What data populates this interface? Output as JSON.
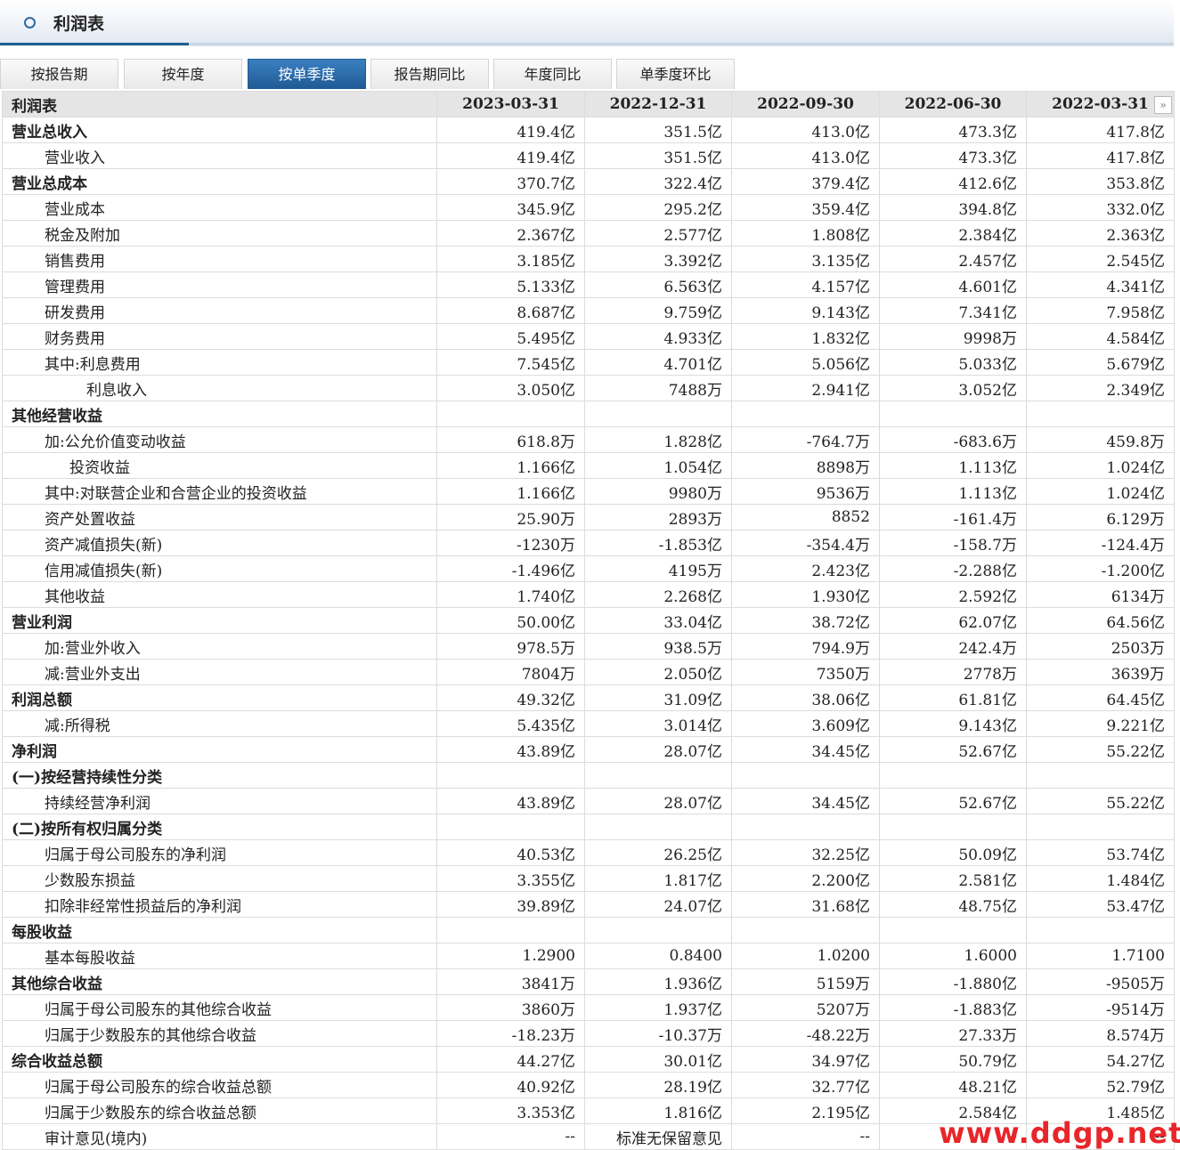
{
  "page_title": "利润表",
  "tabs": [
    {
      "label": "按报告期"
    },
    {
      "label": "按年度"
    },
    {
      "label": "按单季度",
      "active": true
    },
    {
      "label": "报告期同比"
    },
    {
      "label": "年度同比"
    },
    {
      "label": "单季度环比"
    }
  ],
  "table": {
    "header_label": "利润表",
    "columns": [
      "2023-03-31",
      "2022-12-31",
      "2022-09-30",
      "2022-06-30",
      "2022-03-31"
    ],
    "rows": [
      {
        "label": "营业总收入",
        "level": 0,
        "bold": true,
        "values": [
          "419.4亿",
          "351.5亿",
          "413.0亿",
          "473.3亿",
          "417.8亿"
        ]
      },
      {
        "label": "营业收入",
        "level": 1,
        "values": [
          "419.4亿",
          "351.5亿",
          "413.0亿",
          "473.3亿",
          "417.8亿"
        ]
      },
      {
        "label": "营业总成本",
        "level": 0,
        "bold": true,
        "values": [
          "370.7亿",
          "322.4亿",
          "379.4亿",
          "412.6亿",
          "353.8亿"
        ]
      },
      {
        "label": "营业成本",
        "level": 1,
        "values": [
          "345.9亿",
          "295.2亿",
          "359.4亿",
          "394.8亿",
          "332.0亿"
        ]
      },
      {
        "label": "税金及附加",
        "level": 1,
        "values": [
          "2.367亿",
          "2.577亿",
          "1.808亿",
          "2.384亿",
          "2.363亿"
        ]
      },
      {
        "label": "销售费用",
        "level": 1,
        "values": [
          "3.185亿",
          "3.392亿",
          "3.135亿",
          "2.457亿",
          "2.545亿"
        ]
      },
      {
        "label": "管理费用",
        "level": 1,
        "values": [
          "5.133亿",
          "6.563亿",
          "4.157亿",
          "4.601亿",
          "4.341亿"
        ]
      },
      {
        "label": "研发费用",
        "level": 1,
        "values": [
          "8.687亿",
          "9.759亿",
          "9.143亿",
          "7.341亿",
          "7.958亿"
        ]
      },
      {
        "label": "财务费用",
        "level": 1,
        "values": [
          "5.495亿",
          "4.933亿",
          "1.832亿",
          "9998万",
          "4.584亿"
        ]
      },
      {
        "label": "其中:利息费用",
        "level": 1,
        "values": [
          "7.545亿",
          "4.701亿",
          "5.056亿",
          "5.033亿",
          "5.679亿"
        ]
      },
      {
        "label": "利息收入",
        "level": 3,
        "values": [
          "3.050亿",
          "7488万",
          "2.941亿",
          "3.052亿",
          "2.349亿"
        ]
      },
      {
        "label": "其他经营收益",
        "level": 0,
        "bold": true,
        "values": [
          "",
          "",
          "",
          "",
          ""
        ]
      },
      {
        "label": "加:公允价值变动收益",
        "level": 1,
        "values": [
          "618.8万",
          "1.828亿",
          "-764.7万",
          "-683.6万",
          "459.8万"
        ]
      },
      {
        "label": "投资收益",
        "level": 2,
        "values": [
          "1.166亿",
          "1.054亿",
          "8898万",
          "1.113亿",
          "1.024亿"
        ]
      },
      {
        "label": "其中:对联营企业和合营企业的投资收益",
        "level": 1,
        "values": [
          "1.166亿",
          "9980万",
          "9536万",
          "1.113亿",
          "1.024亿"
        ]
      },
      {
        "label": "资产处置收益",
        "level": 1,
        "values": [
          "25.90万",
          "2893万",
          "8852",
          "-161.4万",
          "6.129万"
        ]
      },
      {
        "label": "资产减值损失(新)",
        "level": 1,
        "values": [
          "-1230万",
          "-1.853亿",
          "-354.4万",
          "-158.7万",
          "-124.4万"
        ]
      },
      {
        "label": "信用减值损失(新)",
        "level": 1,
        "values": [
          "-1.496亿",
          "4195万",
          "2.423亿",
          "-2.288亿",
          "-1.200亿"
        ]
      },
      {
        "label": "其他收益",
        "level": 1,
        "values": [
          "1.740亿",
          "2.268亿",
          "1.930亿",
          "2.592亿",
          "6134万"
        ]
      },
      {
        "label": "营业利润",
        "level": 0,
        "bold": true,
        "values": [
          "50.00亿",
          "33.04亿",
          "38.72亿",
          "62.07亿",
          "64.56亿"
        ]
      },
      {
        "label": "加:营业外收入",
        "level": 1,
        "values": [
          "978.5万",
          "938.5万",
          "794.9万",
          "242.4万",
          "2503万"
        ]
      },
      {
        "label": "减:营业外支出",
        "level": 1,
        "values": [
          "7804万",
          "2.050亿",
          "7350万",
          "2778万",
          "3639万"
        ]
      },
      {
        "label": "利润总额",
        "level": 0,
        "bold": true,
        "values": [
          "49.32亿",
          "31.09亿",
          "38.06亿",
          "61.81亿",
          "64.45亿"
        ]
      },
      {
        "label": "减:所得税",
        "level": 1,
        "values": [
          "5.435亿",
          "3.014亿",
          "3.609亿",
          "9.143亿",
          "9.221亿"
        ]
      },
      {
        "label": "净利润",
        "level": 0,
        "bold": true,
        "values": [
          "43.89亿",
          "28.07亿",
          "34.45亿",
          "52.67亿",
          "55.22亿"
        ]
      },
      {
        "label": "(一)按经营持续性分类",
        "level": 0,
        "bold": true,
        "values": [
          "",
          "",
          "",
          "",
          ""
        ]
      },
      {
        "label": "持续经营净利润",
        "level": 1,
        "values": [
          "43.89亿",
          "28.07亿",
          "34.45亿",
          "52.67亿",
          "55.22亿"
        ]
      },
      {
        "label": "(二)按所有权归属分类",
        "level": 0,
        "bold": true,
        "values": [
          "",
          "",
          "",
          "",
          ""
        ]
      },
      {
        "label": "归属于母公司股东的净利润",
        "level": 1,
        "values": [
          "40.53亿",
          "26.25亿",
          "32.25亿",
          "50.09亿",
          "53.74亿"
        ]
      },
      {
        "label": "少数股东损益",
        "level": 1,
        "values": [
          "3.355亿",
          "1.817亿",
          "2.200亿",
          "2.581亿",
          "1.484亿"
        ]
      },
      {
        "label": "扣除非经常性损益后的净利润",
        "level": 1,
        "values": [
          "39.89亿",
          "24.07亿",
          "31.68亿",
          "48.75亿",
          "53.47亿"
        ]
      },
      {
        "label": "每股收益",
        "level": 0,
        "bold": true,
        "values": [
          "",
          "",
          "",
          "",
          ""
        ]
      },
      {
        "label": "基本每股收益",
        "level": 1,
        "values": [
          "1.2900",
          "0.8400",
          "1.0200",
          "1.6000",
          "1.7100"
        ]
      },
      {
        "label": "其他综合收益",
        "level": 0,
        "bold": true,
        "values": [
          "3841万",
          "1.936亿",
          "5159万",
          "-1.880亿",
          "-9505万"
        ]
      },
      {
        "label": "归属于母公司股东的其他综合收益",
        "level": 1,
        "values": [
          "3860万",
          "1.937亿",
          "5207万",
          "-1.883亿",
          "-9514万"
        ]
      },
      {
        "label": "归属于少数股东的其他综合收益",
        "level": 1,
        "values": [
          "-18.23万",
          "-10.37万",
          "-48.22万",
          "27.33万",
          "8.574万"
        ]
      },
      {
        "label": "综合收益总额",
        "level": 0,
        "bold": true,
        "values": [
          "44.27亿",
          "30.01亿",
          "34.97亿",
          "50.79亿",
          "54.27亿"
        ]
      },
      {
        "label": "归属于母公司股东的综合收益总额",
        "level": 1,
        "values": [
          "40.92亿",
          "28.19亿",
          "32.77亿",
          "48.21亿",
          "52.79亿"
        ]
      },
      {
        "label": "归属于少数股东的综合收益总额",
        "level": 1,
        "values": [
          "3.353亿",
          "1.816亿",
          "2.195亿",
          "2.584亿",
          "1.485亿"
        ]
      },
      {
        "label": "审计意见(境内)",
        "level": 1,
        "values": [
          "--",
          "标准无保留意见",
          "--",
          "--",
          "--"
        ]
      }
    ]
  },
  "scroll_right_icon": "double-chevron-right-icon",
  "watermark": "www.ddgp.net",
  "colors": {
    "accent": "#1f5f94",
    "watermark": "#e8262a"
  }
}
